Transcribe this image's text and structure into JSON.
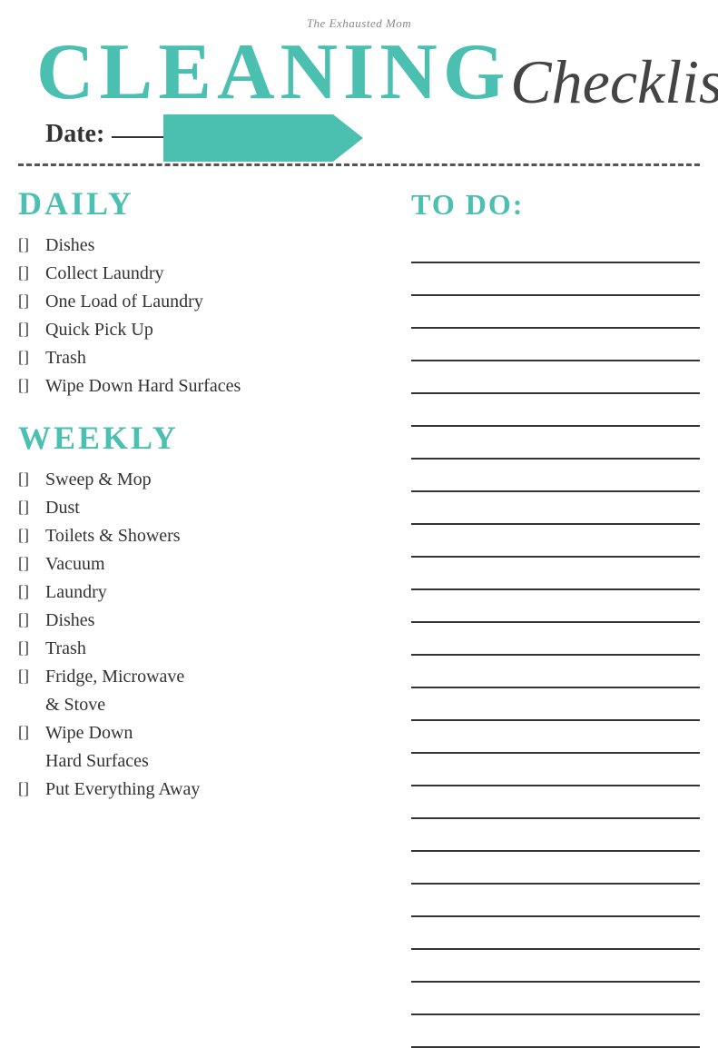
{
  "header": {
    "site_name": "The Exhausted Mom",
    "cleaning": "Cleaning",
    "checklist": "Checklist",
    "date_label": "Date:"
  },
  "daily": {
    "heading": "Daily",
    "items": [
      "Dishes",
      "Collect Laundry",
      "One Load of Laundry",
      "Quick Pick Up",
      "Trash",
      "Wipe Down Hard Surfaces"
    ]
  },
  "weekly": {
    "heading": "Weekly",
    "items": [
      "Sweep & Mop",
      "Dust",
      "Toilets & Showers",
      "Vacuum",
      "Laundry",
      "Dishes",
      "Trash",
      "Fridge, Microwave & Stove",
      "Wipe Down Hard Surfaces",
      "Put Everything Away"
    ]
  },
  "todo": {
    "heading": "To Do:",
    "line_count": 25
  },
  "checkbox": "[]"
}
